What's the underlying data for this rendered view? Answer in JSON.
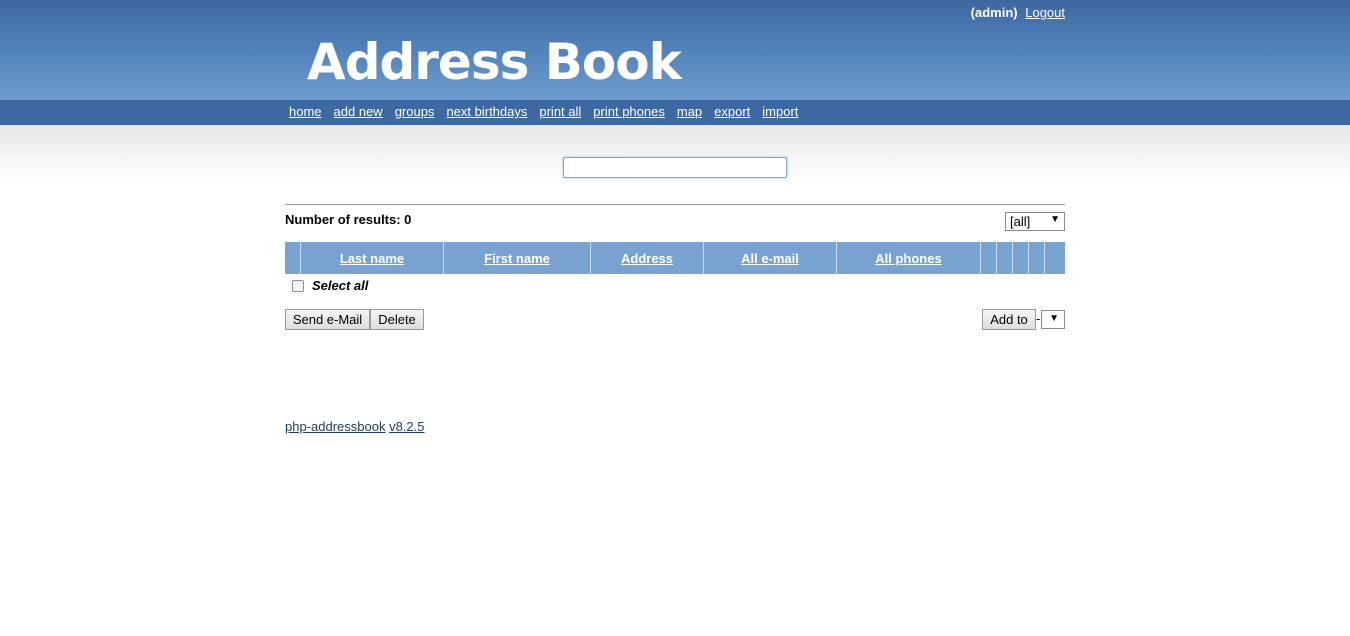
{
  "header": {
    "user": "(admin)",
    "logout_label": "Logout",
    "logo_text": "Address Book"
  },
  "nav": {
    "items": [
      {
        "label": "home"
      },
      {
        "label": "add new"
      },
      {
        "label": "groups"
      },
      {
        "label": "next birthdays"
      },
      {
        "label": "print all"
      },
      {
        "label": "print phones"
      },
      {
        "label": "map"
      },
      {
        "label": "export"
      },
      {
        "label": "import"
      }
    ]
  },
  "search": {
    "value": "",
    "placeholder": ""
  },
  "results": {
    "label": "Number of results: 0"
  },
  "group_filter": {
    "selected": "[all]"
  },
  "table": {
    "columns": [
      {
        "label": ""
      },
      {
        "label": "Last name"
      },
      {
        "label": "First name"
      },
      {
        "label": "Address"
      },
      {
        "label": "All e-mail"
      },
      {
        "label": "All phones"
      },
      {
        "label": ""
      },
      {
        "label": ""
      },
      {
        "label": ""
      },
      {
        "label": ""
      },
      {
        "label": ""
      }
    ]
  },
  "select_all": {
    "label": "Select all"
  },
  "actions": {
    "send_email_label": "Send e-Mail",
    "delete_label": "Delete",
    "add_to_label": "Add to",
    "separator": "-"
  },
  "footer": {
    "app_name": "php-addressbook",
    "version": "v8.2.5"
  },
  "colors": {
    "header_top": "#3d67a0",
    "header_bottom": "#6e9ccf",
    "nav_bg": "#3e68a1",
    "table_header_bg": "#78a2d0"
  }
}
